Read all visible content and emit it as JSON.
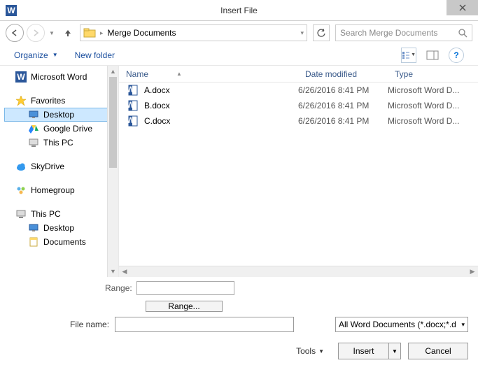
{
  "window": {
    "title": "Insert File"
  },
  "nav": {
    "breadcrumb": "Merge Documents",
    "search_placeholder": "Search Merge Documents"
  },
  "toolbar": {
    "organize": "Organize",
    "new_folder": "New folder"
  },
  "sidebar": {
    "items": [
      {
        "label": "Microsoft Word",
        "icon": "word",
        "indent": 0
      },
      {
        "label": "Favorites",
        "icon": "star",
        "indent": 0,
        "gap_before": true
      },
      {
        "label": "Desktop",
        "icon": "desktop",
        "indent": 1,
        "selected": true
      },
      {
        "label": "Google Drive",
        "icon": "gdrive",
        "indent": 1
      },
      {
        "label": "This PC",
        "icon": "pc",
        "indent": 1
      },
      {
        "label": "SkyDrive",
        "icon": "cloud",
        "indent": 0,
        "gap_before": true
      },
      {
        "label": "Homegroup",
        "icon": "homegroup",
        "indent": 0,
        "gap_before": true
      },
      {
        "label": "This PC",
        "icon": "pc",
        "indent": 0,
        "gap_before": true
      },
      {
        "label": "Desktop",
        "icon": "desktop",
        "indent": 1
      },
      {
        "label": "Documents",
        "icon": "docs",
        "indent": 1
      }
    ]
  },
  "columns": {
    "name": "Name",
    "date": "Date modified",
    "type": "Type"
  },
  "files": [
    {
      "name": "A.docx",
      "date": "6/26/2016 8:41 PM",
      "type": "Microsoft Word D..."
    },
    {
      "name": "B.docx",
      "date": "6/26/2016 8:41 PM",
      "type": "Microsoft Word D..."
    },
    {
      "name": "C.docx",
      "date": "6/26/2016 8:41 PM",
      "type": "Microsoft Word D..."
    }
  ],
  "range": {
    "label": "Range:",
    "button": "Range..."
  },
  "filename": {
    "label": "File name:",
    "value": "",
    "filter": "All Word Documents (*.docx;*.d"
  },
  "buttons": {
    "tools": "Tools",
    "insert": "Insert",
    "cancel": "Cancel"
  }
}
